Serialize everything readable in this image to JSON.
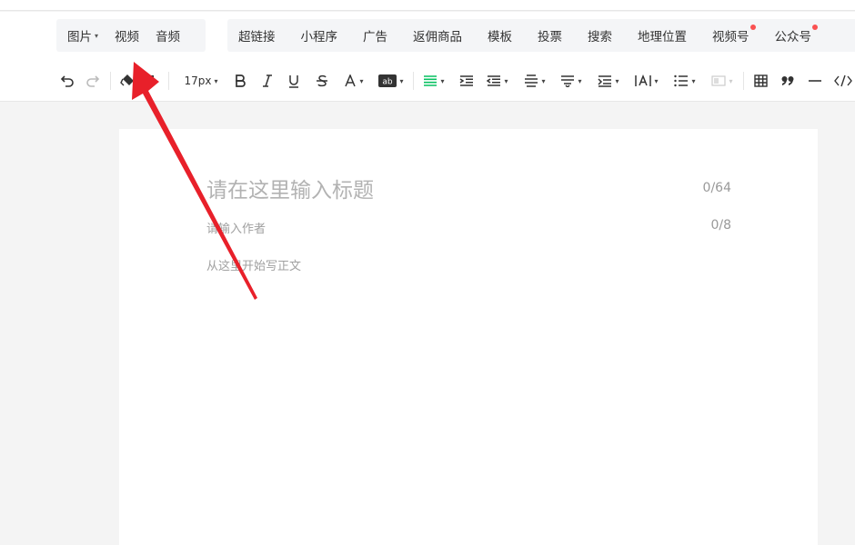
{
  "insert_menu": {
    "group_a": [
      {
        "label": "图片",
        "dropdown": true
      },
      {
        "label": "视频"
      },
      {
        "label": "音频"
      }
    ],
    "group_b": [
      {
        "label": "超链接"
      },
      {
        "label": "小程序"
      },
      {
        "label": "广告"
      },
      {
        "label": "返佣商品"
      },
      {
        "label": "模板"
      },
      {
        "label": "投票"
      },
      {
        "label": "搜索"
      },
      {
        "label": "地理位置"
      },
      {
        "label": "视频号",
        "badge": true
      },
      {
        "label": "公众号",
        "badge": true
      }
    ]
  },
  "toolbar": {
    "font_size": "17px",
    "icons": [
      "undo-icon",
      "redo-icon",
      "format-painter-icon",
      "clear-format-icon",
      "bold-icon",
      "italic-icon",
      "underline-icon",
      "strikethrough-icon",
      "font-color-icon",
      "background-color-icon",
      "align-icon",
      "indent-icon",
      "first-line-indent-icon",
      "paragraph-spacing-icon",
      "line-height-icon",
      "list-indent-icon",
      "letter-spacing-icon",
      "bullet-list-icon",
      "border-icon",
      "table-icon",
      "quote-icon",
      "divider-icon",
      "code-icon"
    ],
    "accent_color": "#07c160"
  },
  "editor": {
    "title_placeholder": "请在这里输入标题",
    "title_count": "0/64",
    "author_placeholder": "请输入作者",
    "author_count": "0/8",
    "body_placeholder": "从这里开始写正文"
  },
  "annotation": {
    "arrow_color": "#e8202a"
  }
}
